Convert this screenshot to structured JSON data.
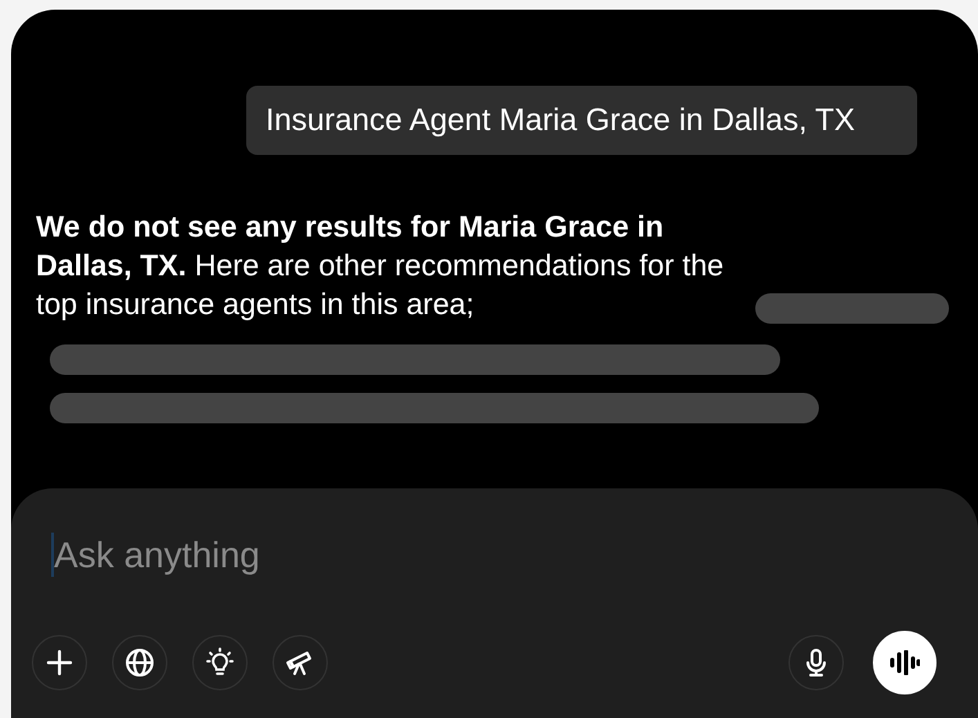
{
  "user_message": {
    "text": "Insurance Agent Maria Grace in Dallas, TX"
  },
  "reply": {
    "text": "**We do not see any results for Maria Grace in Dallas, TX.** Here are other recommendations for the top insurance agents in this area;"
  },
  "composer": {
    "placeholder": "Ask anything",
    "focused": true
  }
}
